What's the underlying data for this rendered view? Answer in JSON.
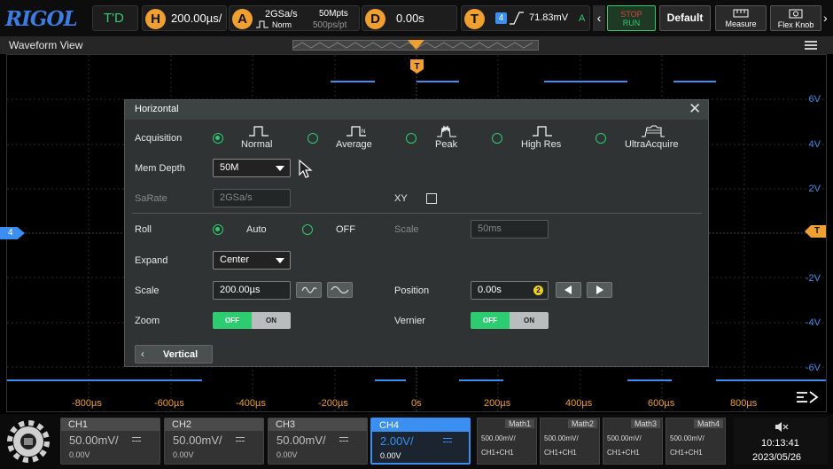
{
  "topbar": {
    "logo": "RIGOL",
    "trig_mode": "T'D",
    "h_label": "H",
    "h_value": "200.00µs/",
    "a_label": "A",
    "a_rate": "2GSa/s",
    "a_mode": "Norm",
    "a_depth": "50Mpts",
    "a_pts": "500ps/pt",
    "d_label": "D",
    "d_value": "0.00s",
    "t_label": "T",
    "t_ch": "4",
    "t_value": "71.83mV",
    "t_mode": "A",
    "stop": "STOP",
    "run": "RUN",
    "default": "Default",
    "measure": "Measure",
    "flexknob": "Flex Knob"
  },
  "waveform": {
    "title": "Waveform View",
    "trigger_marker": "T",
    "ch_marker": "4",
    "y_labels": [
      "6V",
      "4V",
      "2V",
      "-2V",
      "-4V",
      "-6V"
    ],
    "x_labels": [
      "-800µs",
      "-600µs",
      "-400µs",
      "-200µs",
      "0s",
      "200µs",
      "400µs",
      "600µs",
      "800µs"
    ]
  },
  "dialog": {
    "title": "Horizontal",
    "acquisition_label": "Acquisition",
    "acq_options": [
      "Normal",
      "Average",
      "Peak",
      "High Res",
      "UltraAcquire"
    ],
    "memdepth_label": "Mem Depth",
    "memdepth_value": "50M",
    "sarate_label": "SaRate",
    "sarate_value": "2GSa/s",
    "xy_label": "XY",
    "roll_label": "Roll",
    "roll_auto": "Auto",
    "roll_off": "OFF",
    "scale_roll_label": "Scale",
    "scale_roll_value": "50ms",
    "expand_label": "Expand",
    "expand_value": "Center",
    "scale_label": "Scale",
    "scale_value": "200.00µs",
    "position_label": "Position",
    "position_value": "0.00s",
    "position_badge": "2",
    "zoom_label": "Zoom",
    "zoom_off": "OFF",
    "zoom_on": "ON",
    "vernier_label": "Vernier",
    "vernier_off": "OFF",
    "vernier_on": "ON",
    "vertical_btn": "Vertical"
  },
  "channels": [
    {
      "name": "CH1",
      "scale": "50.00mV/",
      "offset": "0.00V"
    },
    {
      "name": "CH2",
      "scale": "50.00mV/",
      "offset": "0.00V"
    },
    {
      "name": "CH3",
      "scale": "50.00mV/",
      "offset": "0.00V"
    },
    {
      "name": "CH4",
      "scale": "2.00V/",
      "offset": "0.00V"
    }
  ],
  "math": [
    {
      "name": "Math1",
      "value": "500.00mV/",
      "src": "CH1+CH1"
    },
    {
      "name": "Math2",
      "value": "500.00mV/",
      "src": "CH1+CH1"
    },
    {
      "name": "Math3",
      "value": "500.00mV/",
      "src": "CH1+CH1"
    },
    {
      "name": "Math4",
      "value": "500.00mV/",
      "src": "CH1+CH1"
    }
  ],
  "clock": {
    "time": "10:13:41",
    "date": "2023/05/26"
  },
  "colors": {
    "ch4": "#3b8ff0",
    "trigger": "#f0a030",
    "accent": "#2ecc71"
  }
}
